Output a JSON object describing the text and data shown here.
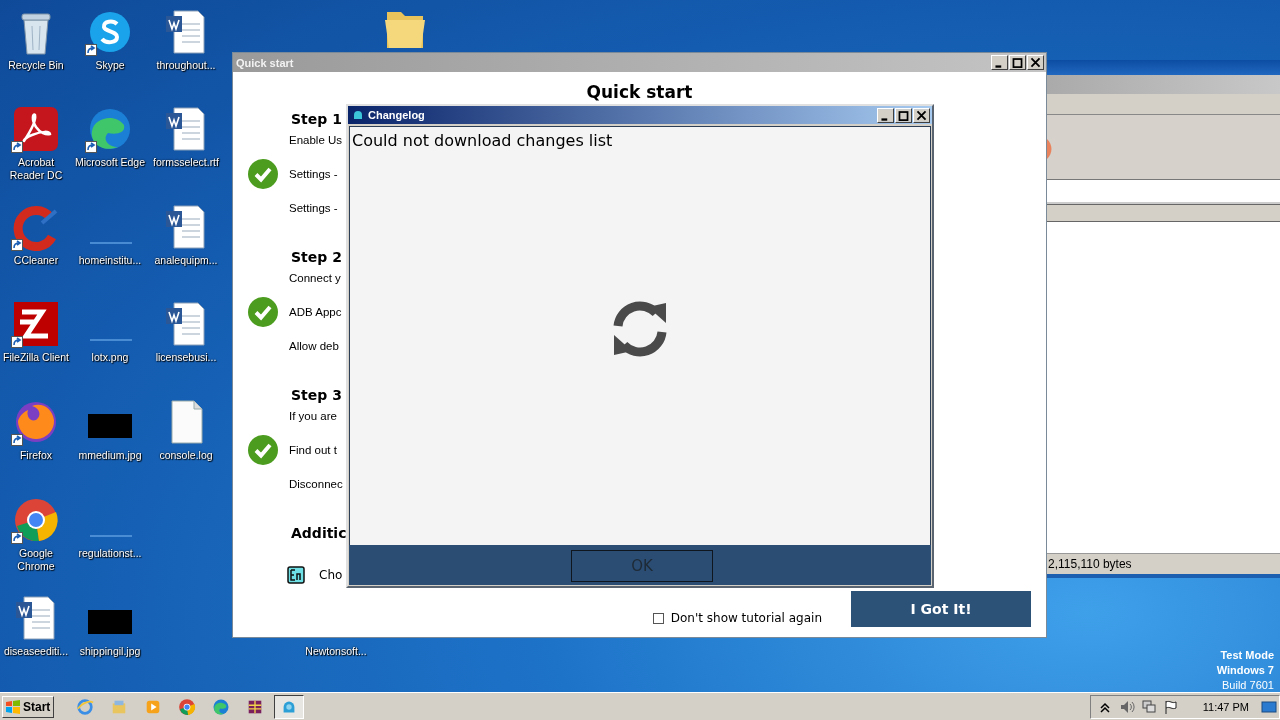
{
  "desktop_icons": [
    {
      "label": "Recycle Bin",
      "kind": "recycle-bin",
      "shortcut": false
    },
    {
      "label": "Acrobat Reader DC",
      "kind": "acrobat",
      "shortcut": true
    },
    {
      "label": "CCleaner",
      "kind": "ccleaner",
      "shortcut": true
    },
    {
      "label": "FileZilla Client",
      "kind": "filezilla",
      "shortcut": true
    },
    {
      "label": "Firefox",
      "kind": "firefox",
      "shortcut": true
    },
    {
      "label": "Google Chrome",
      "kind": "chrome",
      "shortcut": true
    },
    {
      "label": "diseaseediti...",
      "kind": "word-doc",
      "shortcut": false
    },
    {
      "label": "Skype",
      "kind": "skype",
      "shortcut": true
    },
    {
      "label": "Microsoft Edge",
      "kind": "edge",
      "shortcut": true
    },
    {
      "label": "homeinstitu...",
      "kind": "image-blank",
      "shortcut": false
    },
    {
      "label": "lotx.png",
      "kind": "image-blank",
      "shortcut": false
    },
    {
      "label": "mmedium.jpg",
      "kind": "image-black",
      "shortcut": false
    },
    {
      "label": "regulationst...",
      "kind": "image-blank",
      "shortcut": false
    },
    {
      "label": "shippingil.jpg",
      "kind": "image-black",
      "shortcut": false
    },
    {
      "label": "throughout...",
      "kind": "word-doc",
      "shortcut": false
    },
    {
      "label": "formsselect.rtf",
      "kind": "word-doc",
      "shortcut": false
    },
    {
      "label": "analequipm...",
      "kind": "word-doc",
      "shortcut": false
    },
    {
      "label": "licensebusi...",
      "kind": "word-doc",
      "shortcut": false
    },
    {
      "label": "console.log",
      "kind": "text-file",
      "shortcut": false
    },
    {
      "kind": "folder",
      "shortcut": false
    },
    {
      "label": "Newtonsoft...",
      "kind": "hidden"
    }
  ],
  "background_window": {
    "status_text": "2,115,110 bytes"
  },
  "quick_start": {
    "title": "Quick start",
    "heading": "Quick start",
    "steps": [
      {
        "title": "Step 1",
        "lines": [
          {
            "text": "Enable Us",
            "checked": false
          },
          {
            "text": "Settings -",
            "checked": true
          },
          {
            "text": "Settings -",
            "checked": false
          }
        ]
      },
      {
        "title": "Step 2",
        "lines": [
          {
            "text": "Connect y",
            "checked": false
          },
          {
            "text": "ADB Appc",
            "checked": true
          },
          {
            "text": "Allow deb",
            "checked": false
          }
        ]
      },
      {
        "title": "Step 3",
        "lines": [
          {
            "text": "If you are",
            "checked": false
          },
          {
            "text": "Find out t",
            "checked": true
          },
          {
            "text": "Disconnec",
            "checked": false
          }
        ]
      }
    ],
    "additional": {
      "heading": "Additic",
      "items": [
        {
          "text": "Cho",
          "kind": "language"
        }
      ]
    },
    "dont_show": {
      "label": "Don't show tutorial again",
      "checked": false
    },
    "button": "I Got It!"
  },
  "changelog": {
    "title": "Changelog",
    "message": "Could not download changes list",
    "button": "OK"
  },
  "os_notice": [
    "Test Mode",
    "Windows 7",
    "Build 7601"
  ],
  "taskbar": {
    "start": "Start",
    "apps": [
      {
        "kind": "ie",
        "selected": false
      },
      {
        "kind": "explorer",
        "selected": false
      },
      {
        "kind": "media",
        "selected": false
      },
      {
        "kind": "chrome",
        "selected": false
      },
      {
        "kind": "edge",
        "selected": false
      },
      {
        "kind": "archive",
        "selected": false
      },
      {
        "kind": "android",
        "selected": true
      }
    ],
    "clock": "11:47 PM"
  }
}
